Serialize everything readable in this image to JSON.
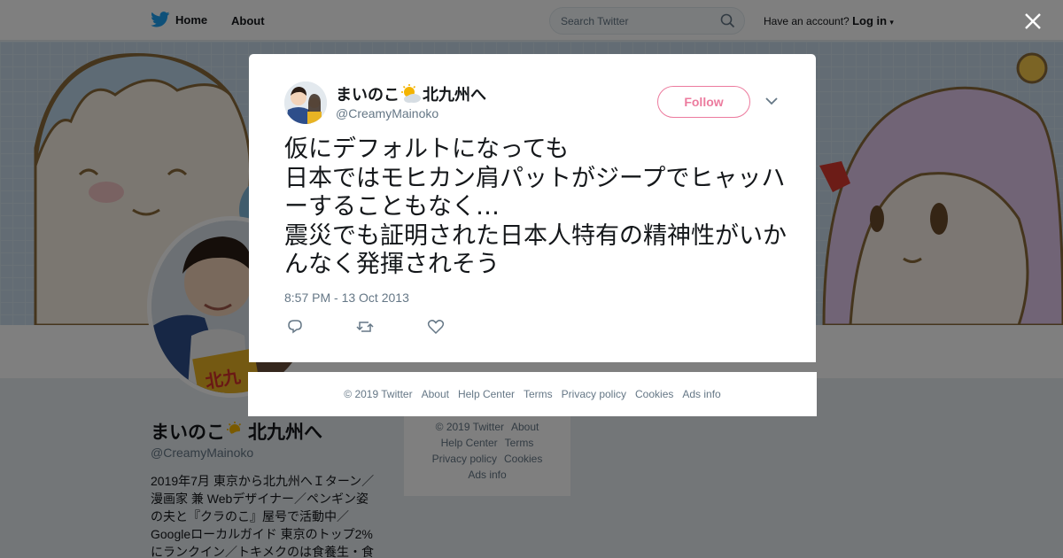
{
  "topbar": {
    "home_label": "Home",
    "about_label": "About",
    "search_placeholder": "Search Twitter",
    "account_prompt": "Have an account?",
    "login_label": "Log in"
  },
  "profile": {
    "name_part1": "まいのこ",
    "name_part2": "北九州へ",
    "handle": "@CreamyMainoko",
    "bio": "2019年7月 東京から北九州へＩターン／漫画家 兼 Webデザイナー／ペンギン姿の夫と『クラのこ』屋号で活動中／Googleローカルガイド 東京のトップ2%にランクイン／トキメクのは食養生・食"
  },
  "sidebar_footer": {
    "links": [
      "© 2019 Twitter",
      "About",
      "Help Center",
      "Terms",
      "Privacy policy",
      "Cookies",
      "Ads info"
    ]
  },
  "tweet": {
    "author_name_part1": "まいのこ",
    "author_name_part2": "北九州へ",
    "author_handle": "@CreamyMainoko",
    "follow_label": "Follow",
    "text": "仮にデフォルトになっても\n日本ではモヒカン肩パットがジープでヒャッハーすることもなく…\n震災でも証明された日本人特有の精神性がいかんなく発揮されそう",
    "timestamp": "8:57 PM - 13 Oct 2013"
  },
  "modal_footer": {
    "links": [
      "© 2019 Twitter",
      "About",
      "Help Center",
      "Terms",
      "Privacy policy",
      "Cookies",
      "Ads info"
    ]
  },
  "colors": {
    "brand_blue": "#1da1f2",
    "follow_pink": "#e0245e",
    "secondary_text": "#657786"
  },
  "icons": {
    "logo": "twitter-bird-icon",
    "search": "search-icon",
    "close": "close-icon",
    "reply": "reply-icon",
    "retweet": "retweet-icon",
    "like": "heart-icon",
    "more": "chevron-down-icon",
    "emoji": "sun-behind-cloud-icon"
  }
}
